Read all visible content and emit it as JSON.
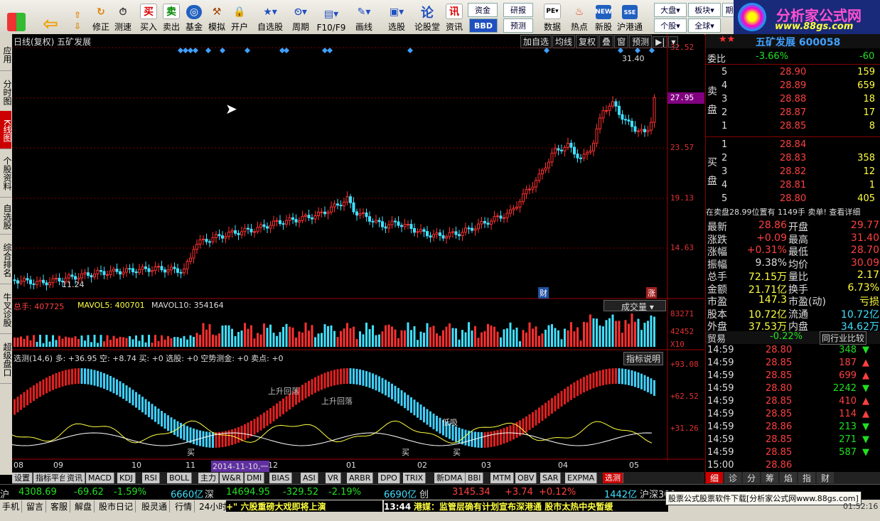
{
  "toolbar": {
    "buttons": [
      "买入",
      "卖出",
      "基金",
      "模拟",
      "开户",
      "自选股",
      "周期",
      "F10/F9",
      "画线",
      "选股",
      "论股堂",
      "资讯",
      "数据",
      "热点",
      "新股",
      "沪港通"
    ],
    "nav_buttons": [
      "修正",
      "测速"
    ],
    "small": {
      "zj": "资金",
      "bbd": "BBD",
      "yb": "研报",
      "yg": "预测",
      "dapan": "大盘",
      "bankuai": "板块",
      "gegu": "个股",
      "quanqiu": "全球",
      "qi": "期"
    },
    "logo_title": "分析家公式网",
    "logo_url": "www.88gs.com"
  },
  "left_tabs": [
    "应用",
    "分时图",
    "K线图",
    "个股资料",
    "自选股",
    "综合排名",
    "牛叉诊股",
    "超级盘口"
  ],
  "chart": {
    "title": "日线(复权) 五矿发展",
    "top_buttons": [
      "加自选",
      "均线",
      "复权",
      "叠",
      "窗",
      "预测",
      "▶|"
    ],
    "price_axis": [
      "32.52",
      "27.95",
      "23.57",
      "19.13",
      "14.63"
    ],
    "price_tag": "27.95",
    "high_label": "31.40",
    "low_label": "11.24",
    "cai_tag": "财",
    "zhang_tag": "涨",
    "vol_header": {
      "zongshou": "总手: 407725",
      "mavol5": "MAVOL5: 400701",
      "mavol10": "MAVOL10: 354164"
    },
    "vol_dropdown": "成交量",
    "vol_axis": [
      "83271",
      "42452",
      "X10"
    ],
    "ind_header": "选测(14,6) 多: +36.95  空: +8.74  买: +0  选股: +0  空势测金: +0  卖点: +0",
    "ind_btn": "指标说明",
    "ind_axis": [
      "+93.08",
      "+62.52",
      "+31.26"
    ],
    "annotations": [
      "上升回落",
      "上升回落",
      "低吸",
      "买",
      "买",
      "买"
    ],
    "x_labels": [
      "08",
      "09",
      "10",
      "11",
      "12",
      "01",
      "02",
      "03",
      "04",
      "05"
    ],
    "date_tag": "2014-11-10,一"
  },
  "chart_data": {
    "type": "candlestick",
    "title": "日线(复权) 五矿发展",
    "ylim": [
      11.24,
      32.52
    ],
    "x_months": [
      "08",
      "09",
      "10",
      "11",
      "12",
      "01",
      "02",
      "03",
      "04",
      "05"
    ],
    "high": 31.4,
    "low": 11.24,
    "last": 28.86
  },
  "bottom_tabs": [
    "设置",
    "指标平台",
    "资讯",
    "MACD",
    "KDJ",
    "RSI",
    "BOLL",
    "主力",
    "W&R",
    "DMI",
    "BIAS",
    "ASI",
    "VR",
    "ARBR",
    "DPO",
    "TRIX",
    "新DMA",
    "BBI",
    "MTM",
    "OBV",
    "SAR",
    "EXPMA",
    "选测"
  ],
  "right": {
    "title": "五矿发展 600058",
    "weibi_label": "委比",
    "weibi": "-3.66%",
    "weibi2": "-60",
    "sell": [
      {
        "n": "5",
        "p": "28.90",
        "v": "159"
      },
      {
        "n": "4",
        "p": "28.89",
        "v": "659"
      },
      {
        "n": "3",
        "p": "28.88",
        "v": "18"
      },
      {
        "n": "2",
        "p": "28.87",
        "v": "17"
      },
      {
        "n": "1",
        "p": "28.85",
        "v": "8"
      }
    ],
    "buy": [
      {
        "n": "1",
        "p": "28.84",
        "v": ""
      },
      {
        "n": "2",
        "p": "28.83",
        "v": "358"
      },
      {
        "n": "3",
        "p": "28.82",
        "v": "12"
      },
      {
        "n": "4",
        "p": "28.81",
        "v": "1"
      },
      {
        "n": "5",
        "p": "28.80",
        "v": "405"
      }
    ],
    "sell_label": "卖盘",
    "buy_label": "买盘",
    "notice": "在卖盘28.99位置有 1149手 卖单! 查看详细",
    "stats": [
      [
        "最新",
        "28.86",
        "开盘",
        "29.77"
      ],
      [
        "涨跌",
        "+0.09",
        "最高",
        "31.40"
      ],
      [
        "涨幅",
        "+0.31%",
        "最低",
        "28.70"
      ],
      [
        "振幅",
        "9.38%",
        "均价",
        "30.09"
      ],
      [
        "总手",
        "72.15万",
        "量比",
        "2.17"
      ],
      [
        "金额",
        "21.71亿",
        "换手",
        "6.73%"
      ],
      [
        "市盈",
        "147.3",
        "市盈(动)",
        "亏损"
      ],
      [
        "股本",
        "10.72亿",
        "流通",
        "10.72亿"
      ],
      [
        "外盘",
        "37.53万",
        "内盘",
        "34.62万"
      ]
    ],
    "industry": "贸易",
    "industry_pct": "-0.22%",
    "industry_btn": "同行业比较",
    "ticks": [
      [
        "14:59",
        "28.80",
        "348",
        "down"
      ],
      [
        "14:59",
        "28.85",
        "187",
        "up"
      ],
      [
        "14:59",
        "28.85",
        "699",
        "up"
      ],
      [
        "14:59",
        "28.80",
        "2242",
        "down"
      ],
      [
        "14:59",
        "28.85",
        "410",
        "up"
      ],
      [
        "14:59",
        "28.85",
        "114",
        "up"
      ],
      [
        "14:59",
        "28.86",
        "213",
        "down"
      ],
      [
        "14:59",
        "28.85",
        "271",
        "down"
      ],
      [
        "14:59",
        "28.85",
        "587",
        "down"
      ],
      [
        "15:00",
        "28.86",
        "",
        ""
      ]
    ],
    "tabs": [
      "细",
      "诊",
      "分",
      "筹",
      "焰",
      "指",
      "财"
    ]
  },
  "status1": {
    "sh_label": "沪",
    "sh_idx": "4308.69",
    "sh_chg": "-69.62",
    "sh_pct": "-1.59%",
    "sh_amt": "6660亿",
    "sz_label": "深",
    "sz_idx": "14694.95",
    "sz_chg": "-329.52",
    "sz_pct": "-2.19%",
    "sz_amt": "6690亿",
    "cy_label": "创",
    "cy_idx": "3145.34",
    "cy_chg": "+3.74",
    "cy_pct": "+0.12%",
    "cy_amt": "1442亿",
    "hs_label": "沪深300"
  },
  "status2": {
    "tabs": [
      "手机",
      "留言",
      "客服",
      "解盘",
      "股市日记",
      "股灵通",
      "行情",
      "24小时滚动"
    ],
    "news1": "+\" 六股重磅大戏即将上演",
    "news_time": "13:44",
    "news2": "港媒：监管层确有计划宣布深港通 股市太热中央暂缓",
    "watermark": "股票公式股票软件下载[分析家公式网www.88gs.com]",
    "clock": "01:52:16"
  }
}
